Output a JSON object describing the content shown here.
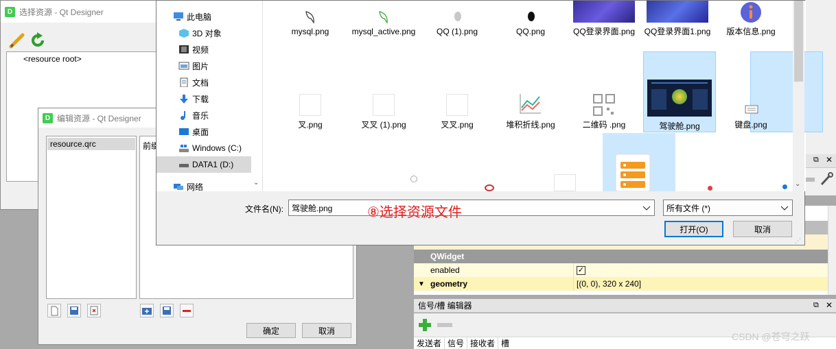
{
  "select_dialog": {
    "title": "选择资源 - Qt Designer",
    "tree_root": "<resource root>"
  },
  "edit_dialog": {
    "title": "编辑资源 - Qt Designer",
    "list_item": "resource.qrc",
    "prefix_label": "前缀",
    "ok_label": "确定",
    "cancel_label": "取消"
  },
  "file_dialog": {
    "nav": [
      {
        "label": "此电脑",
        "icon": "pc-icon"
      },
      {
        "label": "3D 对象",
        "icon": "3d-objects-icon"
      },
      {
        "label": "视频",
        "icon": "video-icon"
      },
      {
        "label": "图片",
        "icon": "pictures-icon"
      },
      {
        "label": "文档",
        "icon": "documents-icon"
      },
      {
        "label": "下载",
        "icon": "download-icon"
      },
      {
        "label": "音乐",
        "icon": "music-icon"
      },
      {
        "label": "桌面",
        "icon": "desktop-icon"
      },
      {
        "label": "Windows (C:)",
        "icon": "drive-c-icon"
      },
      {
        "label": "DATA1 (D:)",
        "icon": "drive-d-icon"
      },
      {
        "label": "网络",
        "icon": "network-icon"
      }
    ],
    "files_row1": [
      "mysql.png",
      "mysql_active.png",
      "QQ (1).png",
      "QQ.png",
      "QQ登录界面.png",
      "QQ登录界面1.png",
      "版本信息.png"
    ],
    "files_row2": [
      "叉.png",
      "叉叉 (1).png",
      "叉叉.png",
      "堆积折线.png",
      "二维码 .png",
      "驾驶舱.png",
      "键盘.png"
    ],
    "filename_label": "文件名(N):",
    "filename_value": "驾驶舱.png",
    "filetype_value": "所有文件 (*)",
    "open_label": "打开(O)",
    "cancel_label": "取消",
    "annotation": "⑧选择资源文件"
  },
  "designer": {
    "section_qwidget": "QWidget",
    "prop_enabled": "enabled",
    "prop_geometry": "geometry",
    "geometry_value": "[(0, 0), 320 x 240]",
    "signal_editor_title": "信号/槽 编辑器",
    "columns": [
      "发送者",
      "信号",
      "接收者",
      "槽"
    ]
  },
  "watermark": "CSDN @苍穹之跃"
}
